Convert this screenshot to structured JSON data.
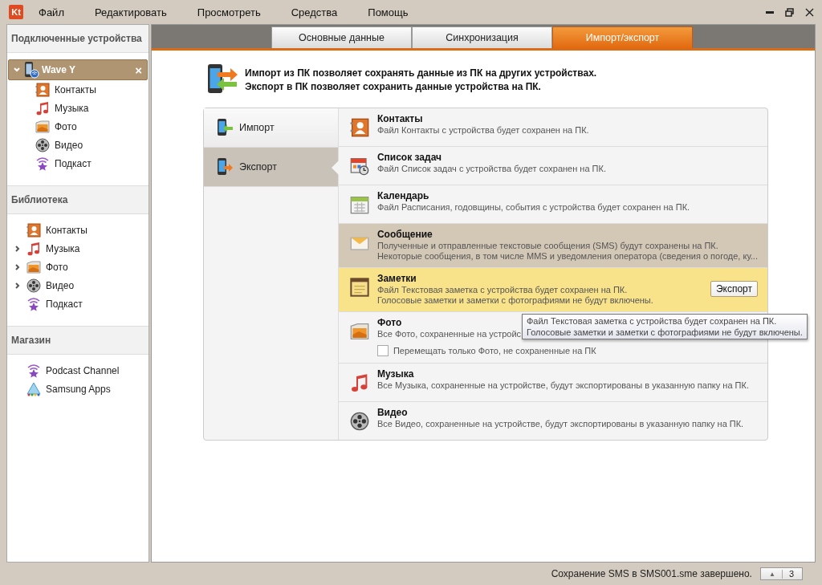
{
  "menu": [
    "Файл",
    "Редактировать",
    "Просмотреть",
    "Средства",
    "Помощь"
  ],
  "app_logo": "Kt",
  "sidebar": {
    "sections": [
      {
        "title": "Подключенные устройства",
        "items": [
          {
            "label": "Wave Y",
            "kind": "device",
            "selected": true,
            "expanded": true,
            "close_mark": "×",
            "children": [
              {
                "label": "Контакты",
                "kind": "contacts"
              },
              {
                "label": "Музыка",
                "kind": "music"
              },
              {
                "label": "Фото",
                "kind": "photo"
              },
              {
                "label": "Видео",
                "kind": "video"
              },
              {
                "label": "Подкаст",
                "kind": "podcast"
              }
            ]
          }
        ]
      },
      {
        "title": "Библиотека",
        "items": [
          {
            "label": "Контакты",
            "kind": "contacts",
            "expandable": false
          },
          {
            "label": "Музыка",
            "kind": "music",
            "expandable": true
          },
          {
            "label": "Фото",
            "kind": "photo",
            "expandable": true
          },
          {
            "label": "Видео",
            "kind": "video",
            "expandable": true
          },
          {
            "label": "Подкаст",
            "kind": "podcast",
            "expandable": false
          }
        ]
      },
      {
        "title": "Магазин",
        "items": [
          {
            "label": "Podcast Channel",
            "kind": "podcast",
            "expandable": false
          },
          {
            "label": "Samsung Apps",
            "kind": "apps",
            "expandable": false
          }
        ]
      }
    ]
  },
  "tabs": [
    {
      "label": "Основные данные",
      "selected": false
    },
    {
      "label": "Синхронизация",
      "selected": false
    },
    {
      "label": "Импорт/экспорт",
      "selected": true
    }
  ],
  "intro": [
    "Импорт из ПК позволяет сохранять данные из ПК на других устройствах.",
    "Экспорт в ПК позволяет сохранить данные устройства на ПК."
  ],
  "modes": [
    {
      "label": "Импорт",
      "kind": "import",
      "selected": false
    },
    {
      "label": "Экспорт",
      "kind": "export",
      "selected": true
    }
  ],
  "items": [
    {
      "title": "Контакты",
      "kind": "contacts",
      "selected": false,
      "highlighted": false,
      "lines": [
        "Файл Контакты с устройства будет сохранен на ПК."
      ]
    },
    {
      "title": "Список задач",
      "kind": "tasks",
      "selected": false,
      "highlighted": false,
      "lines": [
        "Файл Список задач с устройства будет сохранен на ПК."
      ]
    },
    {
      "title": "Календарь",
      "kind": "calendar",
      "selected": false,
      "highlighted": false,
      "lines": [
        "Файл Расписания, годовщины, события с устройства будет сохранен на ПК."
      ]
    },
    {
      "title": "Сообщение",
      "kind": "message",
      "selected": true,
      "highlighted": false,
      "lines": [
        "Полученные и отправленные текстовые сообщения (SMS) будут сохранены на ПК.",
        "Некоторые сообщения, в том числе MMS и уведомления оператора (сведения о погоде, ку..."
      ]
    },
    {
      "title": "Заметки",
      "kind": "notes",
      "selected": false,
      "highlighted": true,
      "button": "Экспорт",
      "lines": [
        "Файл Текстовая заметка с устройства будет сохранен на ПК.",
        "Голосовые заметки и заметки с фотографиями не будут включены."
      ]
    },
    {
      "title": "Фото",
      "kind": "photo",
      "selected": false,
      "highlighted": false,
      "lines": [
        "Все Фото, сохраненные на устройс"
      ],
      "checkbox": {
        "label": "Перемещать только Фото, не сохраненные на ПК",
        "checked": false
      }
    },
    {
      "title": "Музыка",
      "kind": "music",
      "selected": false,
      "highlighted": false,
      "lines": [
        "Все Музыка, сохраненные на устройстве, будут экспортированы в указанную папку на ПК."
      ]
    },
    {
      "title": "Видео",
      "kind": "video",
      "selected": false,
      "highlighted": false,
      "lines": [
        "Все Видео, сохраненные на устройстве, будут экспортированы в указанную папку на ПК."
      ]
    }
  ],
  "tooltip": {
    "lines": [
      "Файл Текстовая заметка с устройства будет сохранен на ПК.",
      "Голосовые заметки и заметки с фотографиями не будут включены."
    ]
  },
  "status_bar": {
    "message": "Сохранение SMS в SMS001.sme завершено.",
    "queue_arrow": "▲",
    "queue_count": "3"
  }
}
